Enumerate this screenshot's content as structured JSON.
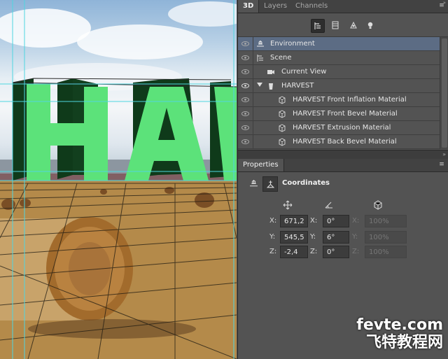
{
  "canvas": {
    "scene_text": "HA",
    "text_color": "#5ce27a",
    "extrusion_color": "#0f3a1a"
  },
  "panel3d": {
    "tabs": [
      {
        "label": "3D"
      },
      {
        "label": "Layers"
      },
      {
        "label": "Channels"
      }
    ],
    "filter_icons": [
      "scene-filter-icon",
      "mesh-filter-icon",
      "material-filter-icon",
      "light-filter-icon"
    ],
    "items": [
      {
        "label": "Environment",
        "icon": "environment-icon",
        "selected": true
      },
      {
        "label": "Scene",
        "icon": "scene-icon"
      },
      {
        "label": "Current View",
        "icon": "camera-icon"
      },
      {
        "label": "HARVEST",
        "icon": "mesh-icon",
        "expanded": true
      },
      {
        "label": "HARVEST Front Inflation Material",
        "icon": "material-icon"
      },
      {
        "label": "HARVEST Front Bevel Material",
        "icon": "material-icon"
      },
      {
        "label": "HARVEST Extrusion Material",
        "icon": "material-icon"
      },
      {
        "label": "HARVEST Back Bevel Material",
        "icon": "material-icon"
      }
    ]
  },
  "properties": {
    "tab": "Properties",
    "section_title": "Coordinates",
    "columns": [
      "position-icon",
      "rotation-icon",
      "scale-icon"
    ],
    "rows": [
      {
        "pos_axis": "X:",
        "pos_value": "671,2",
        "rot_axis": "X:",
        "rot_value": "0°",
        "scale_axis": "X:",
        "scale_value": "100%"
      },
      {
        "pos_axis": "Y:",
        "pos_value": "545,5",
        "rot_axis": "Y:",
        "rot_value": "6°",
        "scale_axis": "Y:",
        "scale_value": "100%"
      },
      {
        "pos_axis": "Z:",
        "pos_value": "-2,4",
        "rot_axis": "Z:",
        "rot_value": "0°",
        "scale_axis": "Z:",
        "scale_value": "100%"
      }
    ]
  },
  "watermark": {
    "line1": "fevte.com",
    "line2": "飞特教程网"
  },
  "colors": {
    "panel_bg": "#535353",
    "selected_row": "#5c6c84",
    "guide_line": "#4fd6e0"
  }
}
